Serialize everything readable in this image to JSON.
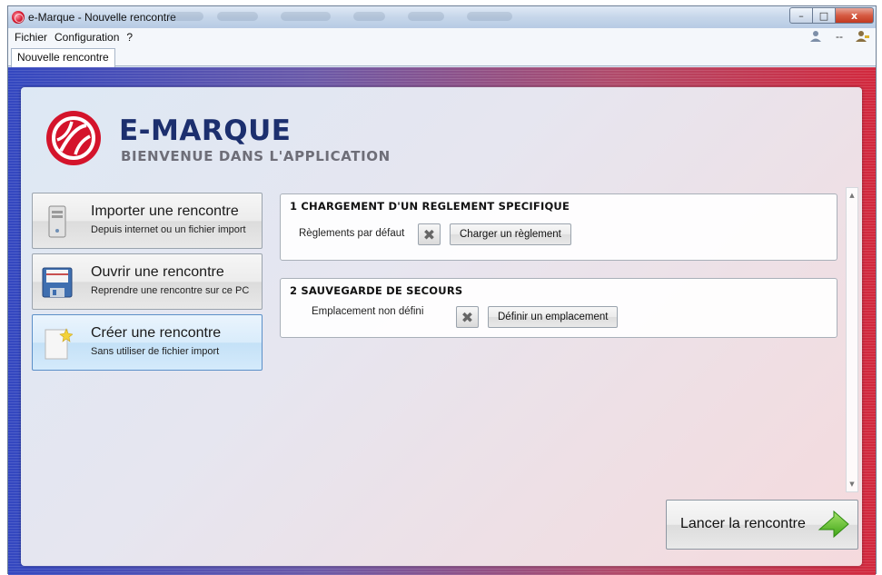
{
  "window": {
    "title": "e-Marque - Nouvelle rencontre",
    "controls": {
      "minimize": "–",
      "maximize": "□",
      "close": "x"
    }
  },
  "menu": {
    "items": [
      "Fichier",
      "Configuration",
      "?"
    ],
    "right_text": "--"
  },
  "tabs": [
    {
      "label": "Nouvelle rencontre",
      "active": true
    }
  ],
  "header": {
    "brand": "E-MARQUE",
    "subtitle": "BIENVENUE DANS L'APPLICATION",
    "logo_icon": "basketball-logo-icon",
    "logo_color": "#d4142b"
  },
  "actions": [
    {
      "title": "Importer une rencontre",
      "subtitle": "Depuis internet ou un fichier import",
      "icon": "server-icon",
      "active": false
    },
    {
      "title": "Ouvrir une rencontre",
      "subtitle": "Reprendre une rencontre sur ce PC",
      "icon": "floppy-disk-icon",
      "active": false
    },
    {
      "title": "Créer une rencontre",
      "subtitle": "Sans utiliser de fichier import",
      "icon": "new-document-icon",
      "active": true
    }
  ],
  "sections": {
    "reglement": {
      "title": "1  CHARGEMENT D'UN REGLEMENT SPECIFIQUE",
      "label": "Règlements par défaut",
      "clear_icon": "✖",
      "button": "Charger un règlement"
    },
    "sauvegarde": {
      "title": "2  SAUVEGARDE DE SECOURS",
      "label": "Emplacement non défini",
      "clear_icon": "✖",
      "button": "Définir un emplacement"
    }
  },
  "launch": {
    "label": "Lancer la rencontre",
    "icon": "green-arrow-icon"
  },
  "colors": {
    "brand_navy": "#1c2f6e",
    "accent_red": "#d4142b",
    "active_blue": "#c4e1f7",
    "arrow_green": "#5cc22c"
  }
}
